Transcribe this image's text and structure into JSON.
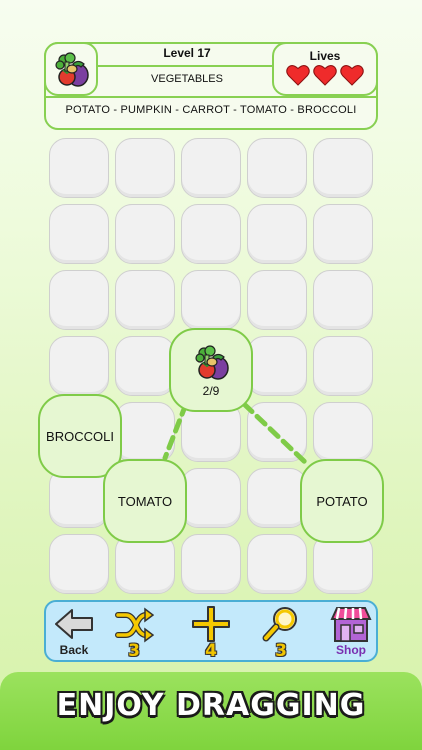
{
  "header": {
    "category_icon": "vegetables-icon",
    "level_label": "Level 17",
    "category": "VEGETABLES",
    "lives_label": "Lives",
    "lives": 3,
    "word_list": "POTATO - PUMPKIN - CARROT - TOMATO - BROCCOLI"
  },
  "board": {
    "center_icon": "vegetables-icon",
    "progress": "2/9",
    "words": {
      "broccoli": "BROCCOLI",
      "tomato": "TOMATO",
      "potato": "POTATO"
    }
  },
  "toolbar": {
    "back_label": "Back",
    "shuffle_count": "3",
    "plus_count": "4",
    "hint_count": "3",
    "shop_label": "Shop"
  },
  "banner": {
    "text": "ENJOY DRAGGING"
  },
  "colors": {
    "accent_green": "#7fcb48",
    "heart_red": "#ef2b2b",
    "toolbar_blue": "#c3e9fb",
    "count_yellow": "#f0c400"
  }
}
